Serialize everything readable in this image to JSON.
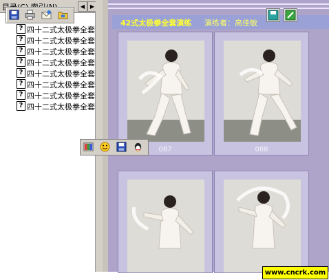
{
  "tabs": {
    "tab_text": "目录(C)   索引(N)"
  },
  "toolbar_top": {
    "buttons": [
      {
        "name": "save-icon"
      },
      {
        "name": "print-icon"
      },
      {
        "name": "email-icon"
      },
      {
        "name": "folder-icon"
      }
    ]
  },
  "sidebar": {
    "items": [
      {
        "label": "四十二式太极拳全套"
      },
      {
        "label": "四十二式太极拳全套"
      },
      {
        "label": "四十二式太极拳全套"
      },
      {
        "label": "四十二式太极拳全套"
      },
      {
        "label": "四十二式太极拳全套"
      },
      {
        "label": "四十二式太极拳全套"
      },
      {
        "label": "四十二式太极拳全套"
      },
      {
        "label": "四十二式太极拳全套"
      }
    ]
  },
  "viewer": {
    "header_title": "42式太极拳全套演练",
    "performer": "演练者：高佳敏",
    "captions": [
      "087",
      "088"
    ]
  },
  "toolbar_float": {
    "buttons": [
      {
        "name": "color-image-icon"
      },
      {
        "name": "smiley-icon"
      },
      {
        "name": "disk-icon"
      },
      {
        "name": "qq-penguin-icon"
      }
    ]
  },
  "watermark": {
    "text": "www.cncrk.com"
  },
  "colors": {
    "page_bg": "#aea3c8",
    "header_bg": "#9aa1d6",
    "title": "#ffff33",
    "badge": "#ffff00"
  }
}
